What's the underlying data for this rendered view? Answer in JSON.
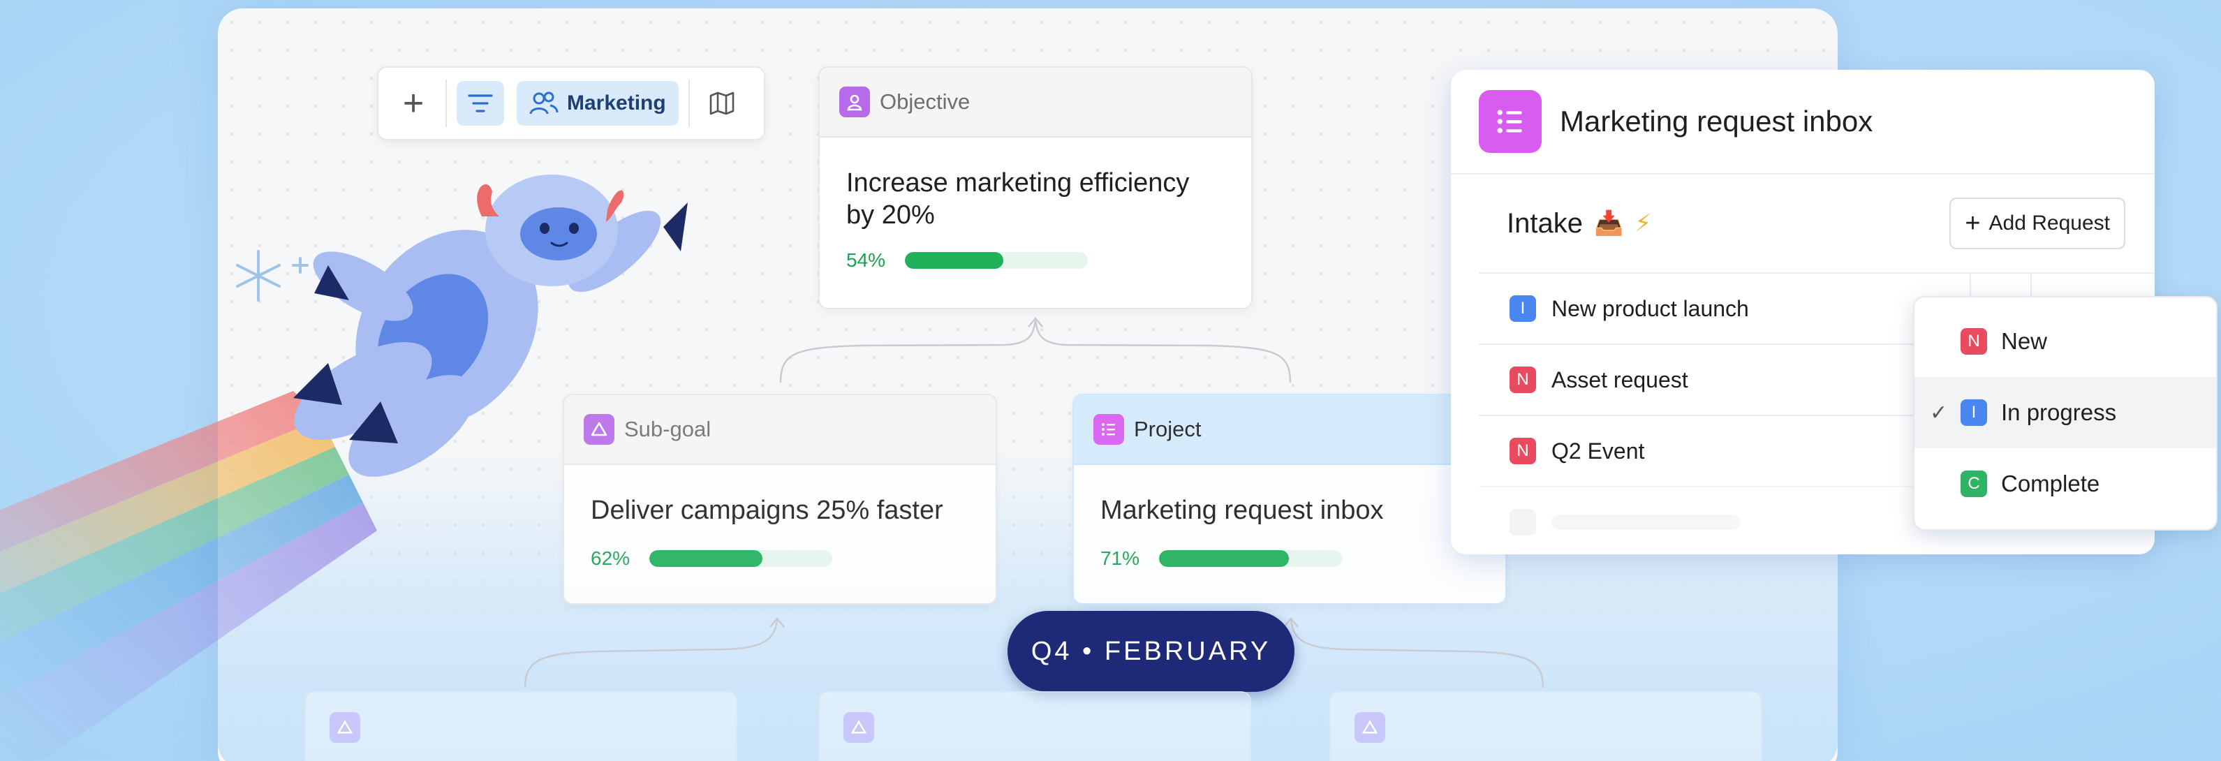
{
  "toolbar": {
    "add_symbol": "+",
    "team_label": "Marketing"
  },
  "objective_card": {
    "header": "Objective",
    "title": "Increase marketing efficiency by 20%",
    "progress_label": "54%",
    "progress": 0.54
  },
  "subgoal_card": {
    "header": "Sub-goal",
    "title": "Deliver campaigns 25% faster",
    "progress_label": "62%",
    "progress": 0.62
  },
  "project_card": {
    "header": "Project",
    "title": "Marketing request inbox",
    "progress_label": "71%",
    "progress": 0.71
  },
  "date_pill": "Q4 • FEBRUARY",
  "inbox": {
    "title": "Marketing request inbox",
    "section_title": "Intake",
    "section_emoji": "📥",
    "section_bolt": "⚡",
    "add_button_label": "Add Request",
    "add_button_symbol": "+",
    "rows": [
      {
        "status_letter": "I",
        "name": "New product launch"
      },
      {
        "status_letter": "N",
        "name": "Asset request"
      },
      {
        "status_letter": "N",
        "name": "Q2 Event"
      }
    ]
  },
  "status_dropdown": {
    "options": [
      {
        "letter": "N",
        "label": "New",
        "selected": false
      },
      {
        "letter": "I",
        "label": "In progress",
        "selected": true
      },
      {
        "letter": "C",
        "label": "Complete",
        "selected": false
      }
    ],
    "check_symbol": "✓"
  },
  "colors": {
    "accent_blue": "#4a86f0",
    "status_new": "#e84a60",
    "status_complete": "#2fb365",
    "progress_green": "#20b15a",
    "pill_navy": "#1e2a78",
    "project_icon": "#d95cf0"
  }
}
